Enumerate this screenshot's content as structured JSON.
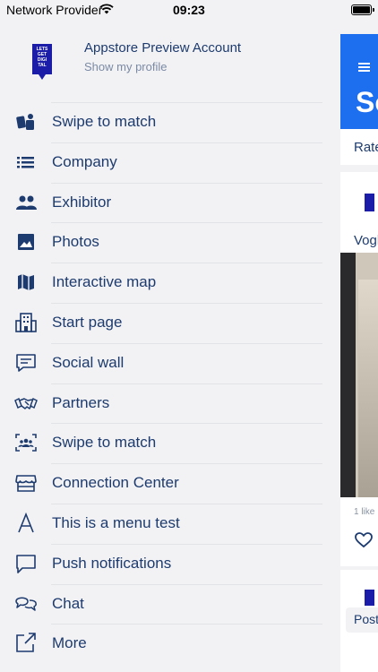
{
  "status_bar": {
    "carrier": "Network Provider",
    "time": "09:23"
  },
  "profile": {
    "name": "Appstore Preview Account",
    "subtitle": "Show my profile",
    "logo_text": "LETS GET DIGI TAL"
  },
  "menu": [
    {
      "label": "Swipe to match",
      "icon": "swipe-cards-icon"
    },
    {
      "label": "Company",
      "icon": "list-icon"
    },
    {
      "label": "Exhibitor",
      "icon": "people-icon"
    },
    {
      "label": "Photos",
      "icon": "image-icon"
    },
    {
      "label": "Interactive map",
      "icon": "map-icon"
    },
    {
      "label": "Start page",
      "icon": "building-icon"
    },
    {
      "label": "Social wall",
      "icon": "chat-bubble-icon"
    },
    {
      "label": "Partners",
      "icon": "handshake-icon"
    },
    {
      "label": "Swipe to match",
      "icon": "group-scan-icon"
    },
    {
      "label": "Connection Center",
      "icon": "storefront-icon"
    },
    {
      "label": "This is a menu test",
      "icon": "letter-a-icon"
    },
    {
      "label": "Push notifications",
      "icon": "message-square-icon"
    },
    {
      "label": "Chat",
      "icon": "chat-bubbles-icon"
    },
    {
      "label": "More",
      "icon": "external-link-icon"
    }
  ],
  "main": {
    "title_partial": "So",
    "tab_partial": "Rate",
    "author_partial": "Vogl",
    "likes_text": "1 like",
    "post_partial": "Post"
  },
  "colors": {
    "accent": "#1d6ff0",
    "text": "#1d3b6e",
    "logo": "#1b1ca8"
  }
}
